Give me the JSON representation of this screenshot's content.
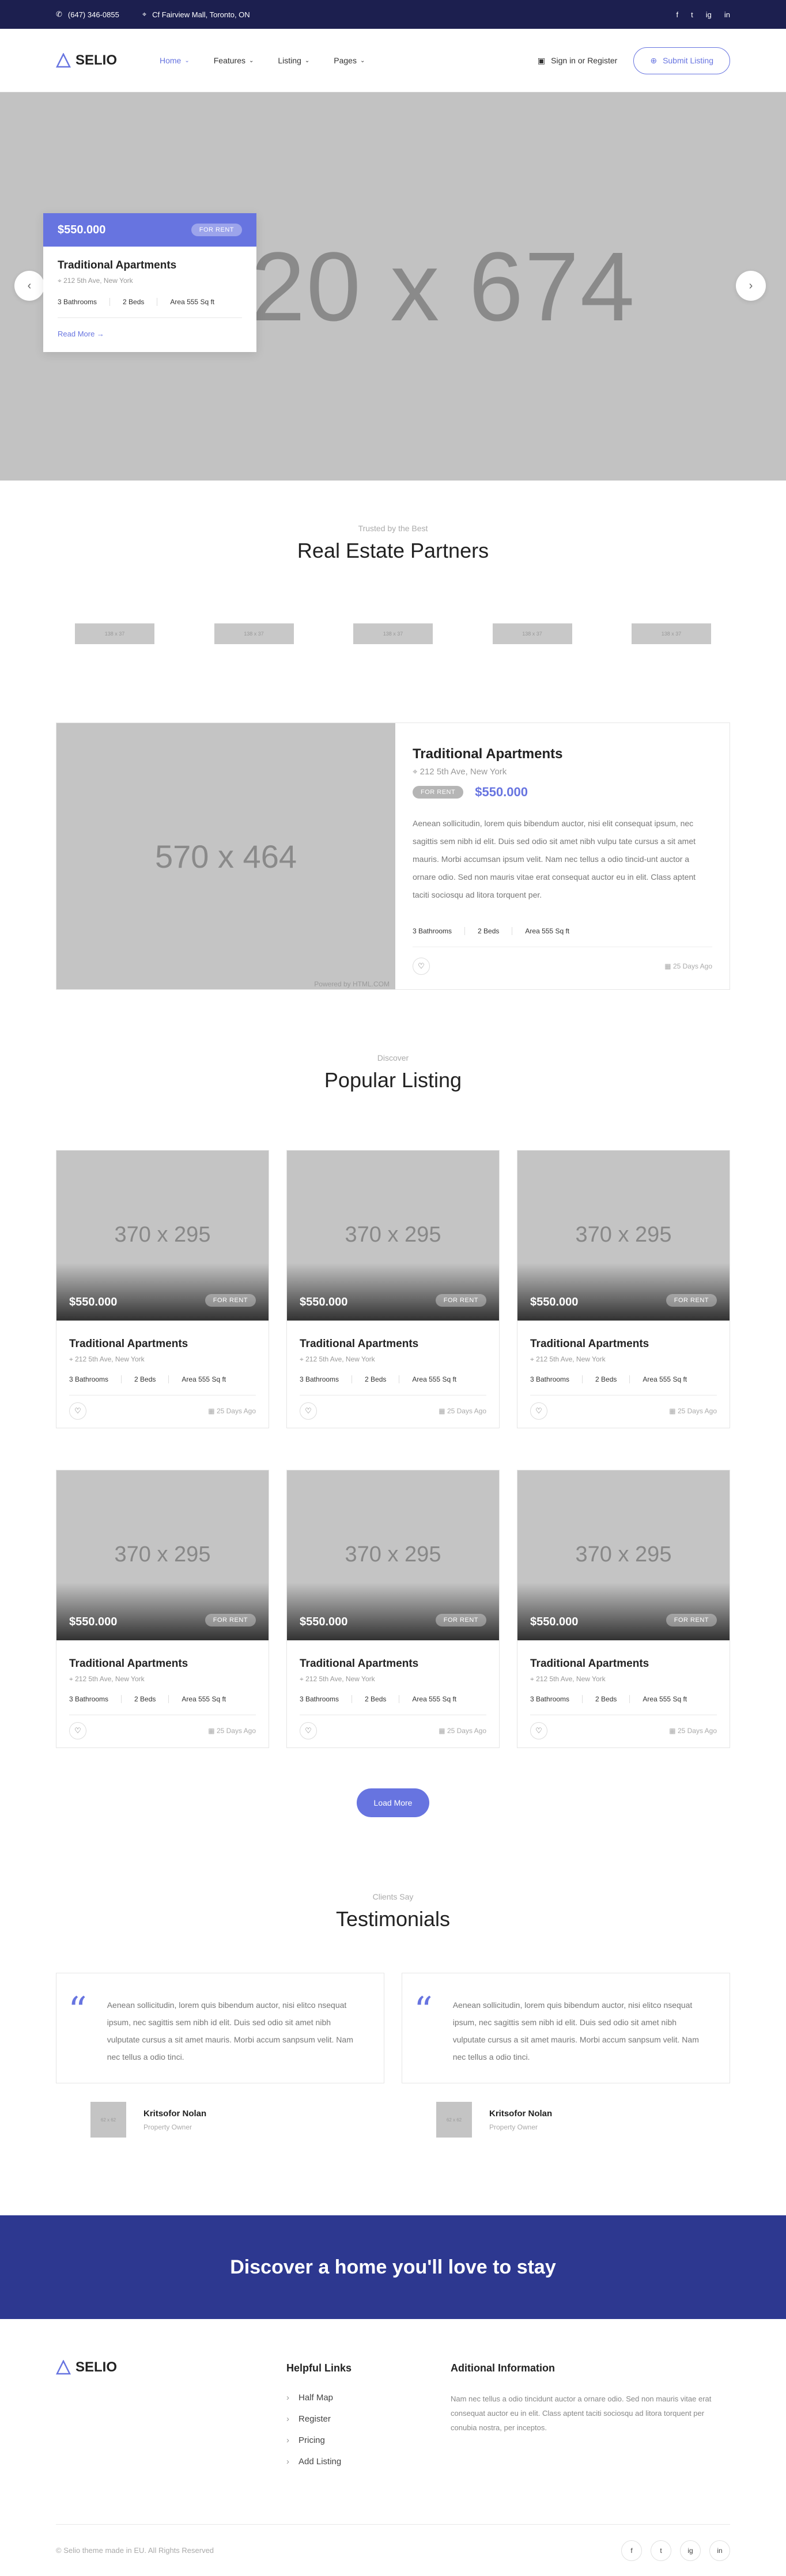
{
  "topbar": {
    "phone": "(647) 346-0855",
    "address": "Cf Fairview Mall, Toronto, ON",
    "social": [
      "f",
      "t",
      "ig",
      "in"
    ]
  },
  "header": {
    "logo": "SELIO",
    "nav": [
      {
        "label": "Home",
        "active": true
      },
      {
        "label": "Features"
      },
      {
        "label": "Listing"
      },
      {
        "label": "Pages"
      }
    ],
    "signin": "Sign in or Register",
    "submit": "Submit Listing"
  },
  "hero": {
    "placeholder": "20 x 674",
    "card": {
      "price": "$550.000",
      "badge": "FOR RENT",
      "title": "Traditional Apartments",
      "address": "212 5th Ave, New York",
      "feats": [
        "3 Bathrooms",
        "2 Beds",
        "Area 555 Sq ft"
      ],
      "readmore": "Read More"
    }
  },
  "partners": {
    "sub": "Trusted by the Best",
    "title": "Real Estate Partners",
    "logos": [
      "138 x 37",
      "138 x 37",
      "138 x 37",
      "138 x 37",
      "138 x 37"
    ]
  },
  "featured": {
    "placeholder": "570 x 464",
    "powered": "Powered by HTML.COM",
    "title": "Traditional Apartments",
    "address": "212 5th Ave, New York",
    "badge": "FOR RENT",
    "price": "$550.000",
    "description": "Aenean sollicitudin, lorem quis bibendum auctor, nisi elit consequat ipsum, nec sagittis sem nibh id elit. Duis sed odio sit amet nibh vulpu tate cursus a sit amet mauris. Morbi accumsan ipsum velit. Nam nec tellus a odio tincid-unt auctor a ornare odio. Sed non mauris vitae erat consequat auctor eu in elit. Class aptent taciti sociosqu ad litora torquent per.",
    "feats": [
      "3 Bathrooms",
      "2 Beds",
      "Area 555 Sq ft"
    ],
    "days": "25 Days Ago"
  },
  "popular": {
    "sub": "Discover",
    "title": "Popular Listing",
    "cards": [
      {
        "img": "370 x 295",
        "price": "$550.000",
        "badge": "FOR RENT",
        "title": "Traditional Apartments",
        "address": "212 5th Ave, New York",
        "feats": [
          "3 Bathrooms",
          "2 Beds",
          "Area 555 Sq ft"
        ],
        "days": "25 Days Ago"
      },
      {
        "img": "370 x 295",
        "price": "$550.000",
        "badge": "FOR RENT",
        "title": "Traditional Apartments",
        "address": "212 5th Ave, New York",
        "feats": [
          "3 Bathrooms",
          "2 Beds",
          "Area 555 Sq ft"
        ],
        "days": "25 Days Ago"
      },
      {
        "img": "370 x 295",
        "price": "$550.000",
        "badge": "FOR RENT",
        "title": "Traditional Apartments",
        "address": "212 5th Ave, New York",
        "feats": [
          "3 Bathrooms",
          "2 Beds",
          "Area 555 Sq ft"
        ],
        "days": "25 Days Ago"
      },
      {
        "img": "370 x 295",
        "price": "$550.000",
        "badge": "FOR RENT",
        "title": "Traditional Apartments",
        "address": "212 5th Ave, New York",
        "feats": [
          "3 Bathrooms",
          "2 Beds",
          "Area 555 Sq ft"
        ],
        "days": "25 Days Ago"
      },
      {
        "img": "370 x 295",
        "price": "$550.000",
        "badge": "FOR RENT",
        "title": "Traditional Apartments",
        "address": "212 5th Ave, New York",
        "feats": [
          "3 Bathrooms",
          "2 Beds",
          "Area 555 Sq ft"
        ],
        "days": "25 Days Ago"
      },
      {
        "img": "370 x 295",
        "price": "$550.000",
        "badge": "FOR RENT",
        "title": "Traditional Apartments",
        "address": "212 5th Ave, New York",
        "feats": [
          "3 Bathrooms",
          "2 Beds",
          "Area 555 Sq ft"
        ],
        "days": "25 Days Ago"
      }
    ],
    "loadmore": "Load More"
  },
  "testimonials": {
    "sub": "Clients Say",
    "title": "Testimonials",
    "items": [
      {
        "text": "Aenean sollicitudin, lorem quis bibendum auctor, nisi elitco nsequat ipsum, nec sagittis sem nibh id elit. Duis sed odio sit amet nibh vulputate cursus a sit amet mauris. Morbi accum sanpsum velit. Nam nec tellus a odio tinci.",
        "avatar": "62 x 62",
        "name": "Kritsofor Nolan",
        "role": "Property Owner"
      },
      {
        "text": "Aenean sollicitudin, lorem quis bibendum auctor, nisi elitco nsequat ipsum, nec sagittis sem nibh id elit. Duis sed odio sit amet nibh vulputate cursus a sit amet mauris. Morbi accum sanpsum velit. Nam nec tellus a odio tinci.",
        "avatar": "62 x 62",
        "name": "Kritsofor Nolan",
        "role": "Property Owner"
      }
    ]
  },
  "cta": {
    "text": "Discover a home you'll love to stay"
  },
  "footer": {
    "logo": "SELIO",
    "links_title": "Helpful Links",
    "links": [
      "Half Map",
      "Register",
      "Pricing",
      "Add Listing"
    ],
    "info_title": "Aditional Information",
    "info_text": "Nam nec tellus a odio tincidunt auctor a ornare odio. Sed non mauris vitae erat consequat auctor eu in elit. Class aptent taciti sociosqu ad litora torquent per conubia nostra, per inceptos.",
    "copyright": "© Selio theme made in EU. All Rights Reserved",
    "social": [
      "f",
      "t",
      "ig",
      "in"
    ]
  },
  "colors": {
    "accent": "#6774e0",
    "topbar": "#1c1f4f",
    "cta": "#2d3890"
  }
}
